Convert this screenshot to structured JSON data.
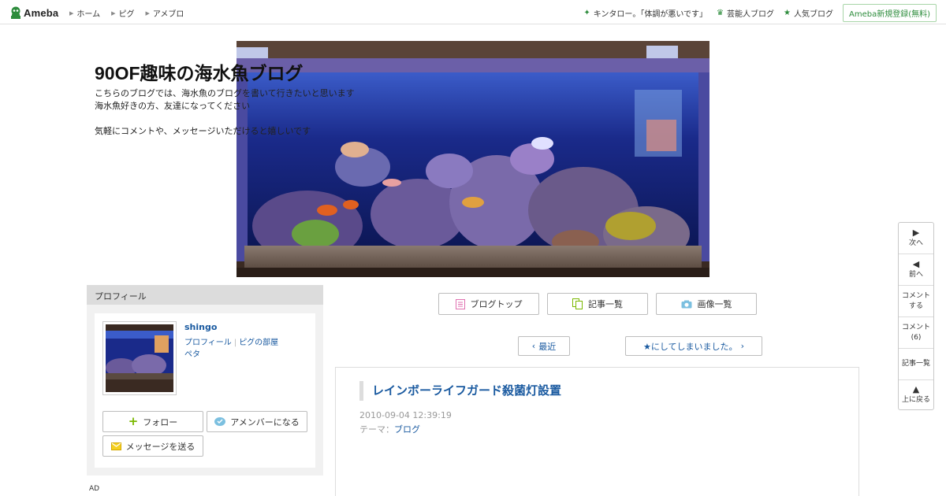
{
  "topbar": {
    "logo_text": "Ameba",
    "nav": [
      "ホーム",
      "ピグ",
      "アメブロ"
    ],
    "right": {
      "trending": "キンタロー。「体調が悪いです」",
      "celeb_blog": "芸能人ブログ",
      "popular_blog": "人気ブログ",
      "signup": "Ameba新規登録(無料)"
    },
    "colors": {
      "accent_green": "#2d8c3c"
    }
  },
  "header": {
    "title": "90OF趣味の海水魚ブログ",
    "description": [
      "こちらのブログでは、海水魚のブログを書いて行きたいと思います",
      "海水魚好きの方、友達になってください",
      "",
      "気軽にコメントや、メッセージいただけると嬉しいです"
    ]
  },
  "profile": {
    "heading": "プロフィール",
    "name": "shingo",
    "links": {
      "profile": "プロフィール",
      "pig_room": "ピグの部屋",
      "peta": "ペタ"
    },
    "buttons": {
      "follow": "フォロー",
      "member": "アメンバーになる",
      "message": "メッセージを送る"
    }
  },
  "ad_label": "AD",
  "main_nav": {
    "blog_top": "ブログトップ",
    "article_list": "記事一覧",
    "image_list": "画像一覧"
  },
  "pager": {
    "recent": "最近",
    "next": "★にしてしまいました。"
  },
  "article": {
    "title": "レインボーライフガード殺菌灯設置",
    "date": "2010-09-04 12:39:19",
    "theme_label": "テーマ：",
    "theme": "ブログ"
  },
  "side_tools": {
    "next": "次へ",
    "prev": "前へ",
    "comment_line1": "コメント",
    "comment_line2": "する",
    "comments_line1": "コメント",
    "comments_count": "(6)",
    "article_list": "記事一覧",
    "back_top": "上に戻る"
  }
}
